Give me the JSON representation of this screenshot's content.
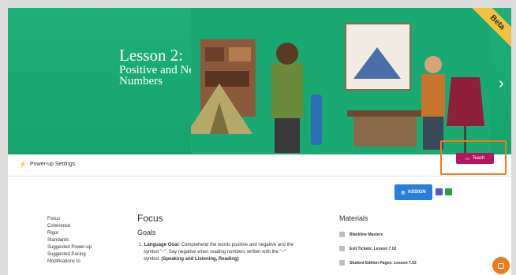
{
  "hero": {
    "title_line1": "Lesson 2:",
    "title_line2": "Positive and Negative",
    "title_line3": "Numbers",
    "badge": "Beta",
    "next_glyph": "›"
  },
  "toolbar": {
    "powerup_label": "Power-up Settings",
    "teach_label": "Teach"
  },
  "actions": {
    "assign_label": "ASSIGN"
  },
  "side_nav": {
    "items": [
      "Focus",
      "Coherence",
      "Rigor",
      "Standards",
      "Suggested Power-up",
      "Suggested Pacing",
      "Modifications to"
    ]
  },
  "focus": {
    "heading": "Focus",
    "subheading": "Goals",
    "goal_number": "1.",
    "goal_label": "Language Goal:",
    "goal_text": " Comprehend the words positive and negative and the symbol \"−\". Say negative when reading numbers written with the \"−\" symbol. ",
    "goal_tag": "(Speaking and Listening, Reading)"
  },
  "materials": {
    "heading": "Materials",
    "items": [
      "Blackline Masters",
      "Exit Tickets: Lesson 7.02",
      "Student Edition Pages: Lesson 7.02"
    ]
  },
  "colors": {
    "hero_green": "#1fb07a",
    "teach_magenta": "#b5155f",
    "highlight_orange": "#f07b1f",
    "assign_blue": "#2a7ed9",
    "beta_yellow": "#f2c33a"
  }
}
